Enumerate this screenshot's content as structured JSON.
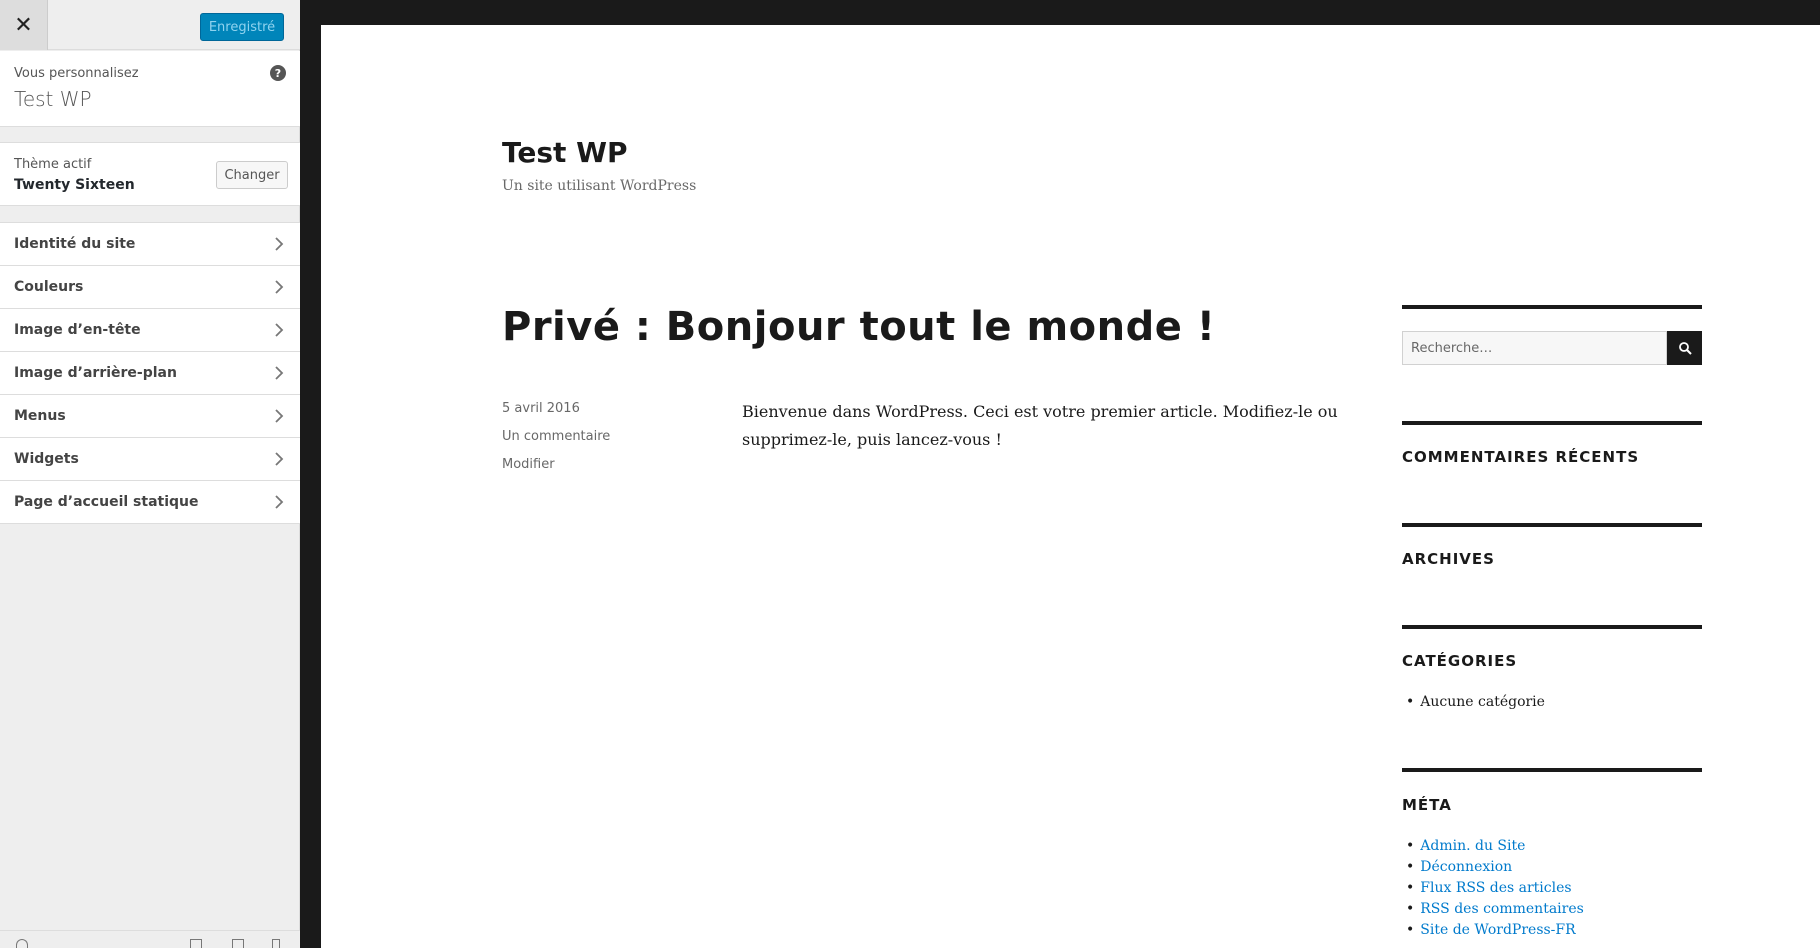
{
  "customizer": {
    "save_label": "Enregistré",
    "info_small": "Vous personnalisez",
    "info_title": "Test WP",
    "theme_small": "Thème actif",
    "theme_name": "Twenty Sixteen",
    "change_label": "Changer",
    "sections": [
      "Identité du site",
      "Couleurs",
      "Image d’en-tête",
      "Image d’arrière-plan",
      "Menus",
      "Widgets",
      "Page d’accueil statique"
    ],
    "accent_color": "#0085ba"
  },
  "preview": {
    "site_title": "Test WP",
    "site_tagline": "Un site utilisant WordPress",
    "post": {
      "title": "Privé : Bonjour tout le monde !",
      "date": "5 avril 2016",
      "comments": "Un commentaire",
      "edit": "Modifier",
      "body": "Bienvenue dans WordPress. Ceci est votre premier article. Modifiez-le ou supprimez-le, puis lancez-vous !"
    },
    "search_placeholder": "Recherche…",
    "widgets": {
      "recent_comments": "COMMENTAIRES RÉCENTS",
      "archives": "ARCHIVES",
      "categories": "CATÉGORIES",
      "categories_items": [
        "Aucune catégorie"
      ],
      "meta": "MÉTA",
      "meta_items": [
        "Admin. du Site",
        "Déconnexion",
        "Flux RSS des articles",
        "RSS des commentaires",
        "Site de WordPress-FR"
      ]
    },
    "link_color": "#007acc"
  }
}
